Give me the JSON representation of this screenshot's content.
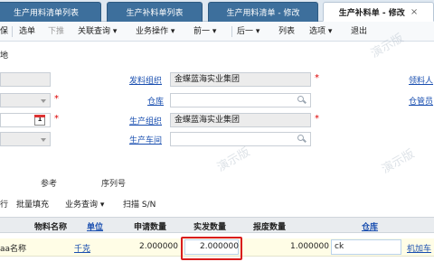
{
  "tabs": [
    {
      "label": "生产用料清单列表"
    },
    {
      "label": "生产补料单列表"
    },
    {
      "label": "生产用料清单 - 修改"
    },
    {
      "label": "生产补料单 - 修改",
      "close": "×"
    }
  ],
  "toolbar": {
    "items": [
      "保",
      "选单",
      "下推",
      "关联查询 ▾",
      "业务操作 ▾",
      "前一 ▾",
      "后一 ▾",
      "列表",
      "选项 ▾",
      "退出"
    ]
  },
  "form": {
    "left_label": "地",
    "issue_org_label": "发料组织",
    "issue_org_value": "金蝶蓝海实业集团",
    "warehouse_label": "仓库",
    "prod_org_label": "生产组织",
    "prod_org_value": "金蝶蓝海实业集团",
    "workshop_label": "生产车间",
    "picker_label": "领料人",
    "keeper_label": "仓管员",
    "calendar_day": "1",
    "required_mark": "*"
  },
  "subtabs": [
    "参考",
    "序列号"
  ],
  "grid_toolbar": [
    "行",
    "批量填充",
    "业务查询 ▾",
    "扫描 S/N"
  ],
  "grid": {
    "headers": [
      "物料名称",
      "单位",
      "申请数量",
      "实发数量",
      "报废数量",
      "仓库"
    ],
    "row": {
      "material": "aa名称",
      "unit": "千克",
      "apply_qty": "2.000000",
      "actual_qty": "2.000000",
      "scrap_qty": "1.000000",
      "warehouse": "ck",
      "extra": "机加车"
    }
  },
  "watermark": "演示版",
  "colors": {
    "tab_inactive": "#3d6f9c",
    "highlight": "#d91c1c",
    "link": "#1a4fb0"
  }
}
